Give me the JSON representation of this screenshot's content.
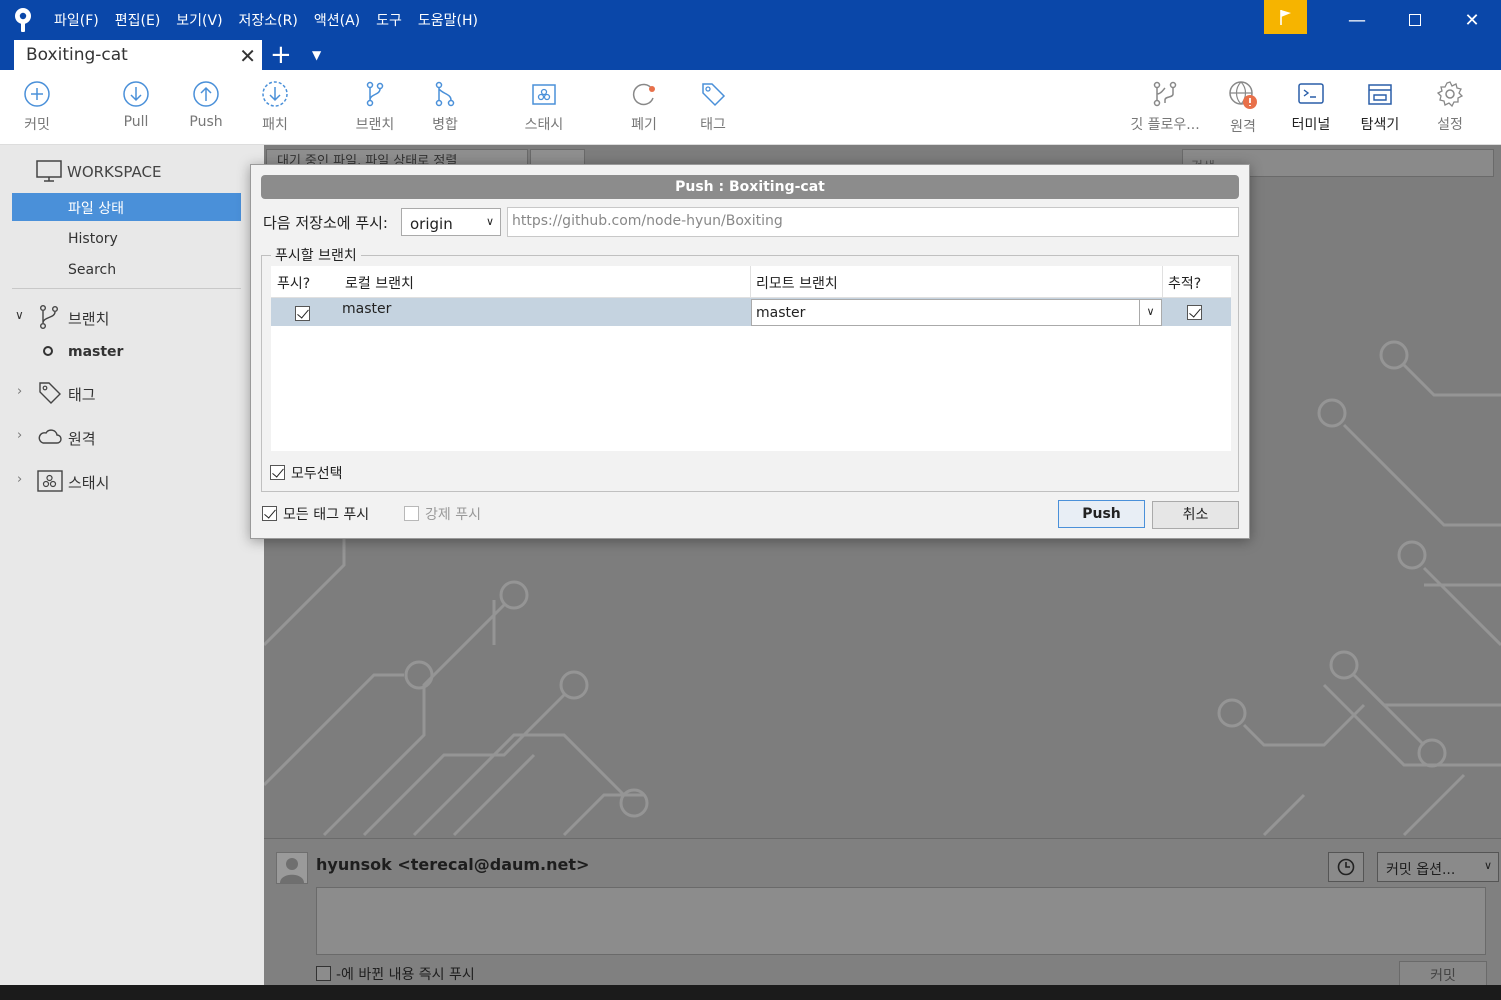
{
  "menu": [
    "파일(F)",
    "편집(E)",
    "보기(V)",
    "저장소(R)",
    "액션(A)",
    "도구",
    "도움말(H)"
  ],
  "tab": {
    "title": "Boxiting-cat"
  },
  "toolbar": {
    "commit": "커밋",
    "pull": "Pull",
    "push": "Push",
    "patch": "패치",
    "branch": "브랜치",
    "merge": "병합",
    "stash": "스태시",
    "discard": "폐기",
    "tag": "태그",
    "gitflow": "깃 플로우...",
    "remote": "원격",
    "terminal": "터미널",
    "explorer": "탐색기",
    "settings": "설정"
  },
  "sidebar": {
    "workspace": "WORKSPACE",
    "file_status": "파일 상태",
    "history": "History",
    "search": "Search",
    "branches": "브랜치",
    "current_branch": "master",
    "tags": "태그",
    "remotes": "원격",
    "stashes": "스태시"
  },
  "main": {
    "filter_label": "대기 중인 파일, 파일 상태로 정렬",
    "search_placeholder": "검색"
  },
  "dialog": {
    "title": "Push :  Boxiting-cat",
    "push_to_label": "다음 저장소에 푸시:",
    "remote_name": "origin",
    "remote_url": "https://github.com/node-hyun/Boxiting",
    "branches_group": "푸시할 브랜치",
    "columns": {
      "push": "푸시?",
      "local": "로컬 브랜치",
      "remote": "리모트 브랜치",
      "track": "추적?"
    },
    "rows": [
      {
        "local": "master",
        "remote": "master",
        "push": true,
        "track": true
      }
    ],
    "select_all": "모두선택",
    "push_all_tags": "모든 태그 푸시",
    "force_push": "강제 푸시",
    "push_button": "Push",
    "cancel_button": "취소"
  },
  "commit": {
    "author": "hyunsok <terecal@daum.net>",
    "options": "커밋 옵션...",
    "push_immediately": "-에 바뀐 내용 즉시 푸시",
    "commit_button": "커밋"
  },
  "colors": {
    "titlebar": "#0a47a9",
    "accent": "#4a90d9",
    "flag": "#f6b400",
    "selection": "#c5d3e0"
  }
}
